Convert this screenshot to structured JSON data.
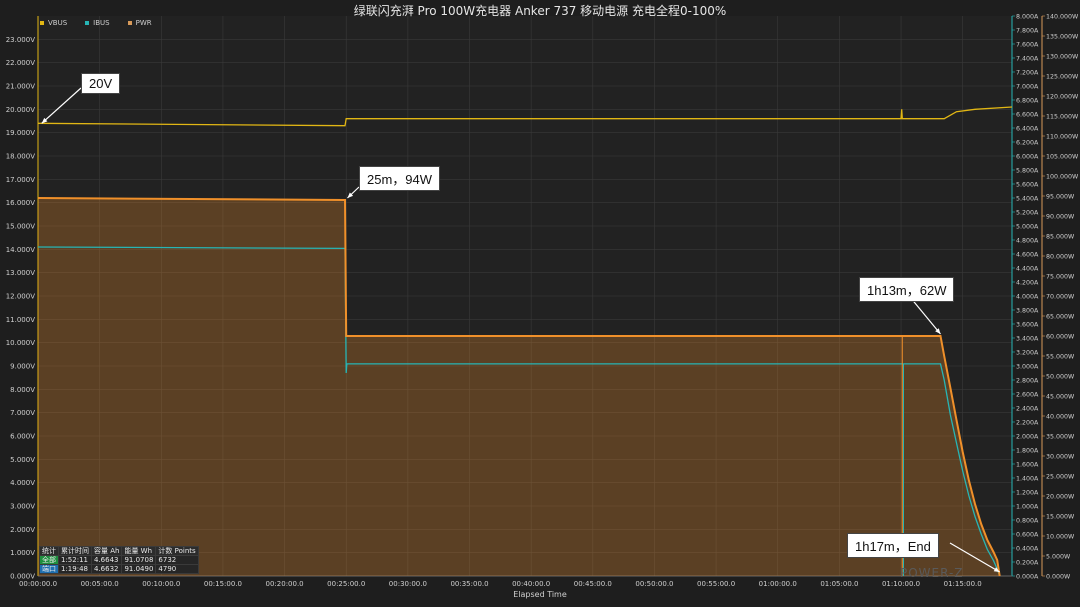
{
  "title": "绿联闪充湃 Pro 100W充电器 Anker 737 移动电源 充电全程0-100%",
  "legend": [
    {
      "name": "VBUS",
      "color": "#e2b714"
    },
    {
      "name": "IBUS",
      "color": "#27b5b5"
    },
    {
      "name": "PWR",
      "color": "#d89a5a"
    }
  ],
  "annotations": [
    {
      "id": "ann-20v",
      "text": "20V"
    },
    {
      "id": "ann-25m",
      "text": "25m，94W"
    },
    {
      "id": "ann-1h13m",
      "text": "1h13m，62W"
    },
    {
      "id": "ann-1h17m",
      "text": "1h17m，End"
    }
  ],
  "stats": {
    "headers": [
      "统计",
      "累计时间",
      "容量 Ah",
      "能量 Wh",
      "计数 Points"
    ],
    "rows": [
      [
        "全部",
        "1:52:11",
        "4.6643",
        "91.0708",
        "6732"
      ],
      [
        "端口",
        "1:19:48",
        "4.6632",
        "91.0490",
        "4790"
      ]
    ]
  },
  "watermark": "POWER-Z",
  "chart_data": {
    "type": "line",
    "xlabel": "Elapsed Time",
    "x_unit": "minutes",
    "xlim": [
      0,
      79
    ],
    "x_ticks": [
      "00:00:00.0",
      "00:05:00.0",
      "00:10:00.0",
      "00:15:00.0",
      "00:20:00.0",
      "00:25:00.0",
      "00:30:00.0",
      "00:35:00.0",
      "00:40:00.0",
      "00:45:00.0",
      "00:50:00.0",
      "00:55:00.0",
      "01:00:00.0",
      "01:05:00.0",
      "01:10:00.0",
      "01:15:00.0"
    ],
    "y_left": {
      "unit": "V",
      "ylim": [
        0,
        24
      ],
      "ticks": [
        "0.000V",
        "1.000V",
        "2.000V",
        "3.000V",
        "4.000V",
        "5.000V",
        "6.000V",
        "7.000V",
        "8.000V",
        "9.000V",
        "10.000V",
        "11.000V",
        "12.000V",
        "13.000V",
        "14.000V",
        "15.000V",
        "16.000V",
        "17.000V",
        "18.000V",
        "19.000V",
        "20.000V",
        "21.000V",
        "22.000V",
        "23.000V"
      ]
    },
    "y_right1": {
      "unit": "A",
      "ylim": [
        0,
        8.0
      ],
      "ticks": [
        "0.000A",
        "0.200A",
        "0.400A",
        "0.600A",
        "0.800A",
        "1.000A",
        "1.200A",
        "1.400A",
        "1.600A",
        "1.800A",
        "2.000A",
        "2.200A",
        "2.400A",
        "2.600A",
        "2.800A",
        "3.000A",
        "3.200A",
        "3.400A",
        "3.600A",
        "3.800A",
        "4.000A",
        "4.200A",
        "4.400A",
        "4.600A",
        "4.800A",
        "5.000A",
        "5.200A",
        "5.400A",
        "5.600A",
        "5.800A",
        "6.000A",
        "6.200A",
        "6.400A",
        "6.600A",
        "6.800A",
        "7.000A",
        "7.200A",
        "7.400A",
        "7.600A",
        "7.800A",
        "8.000A"
      ]
    },
    "y_right2": {
      "unit": "W",
      "ylim": [
        0,
        140
      ],
      "ticks": [
        "0.000W",
        "5.000W",
        "10.000W",
        "15.000W",
        "20.000W",
        "25.000W",
        "30.000W",
        "35.000W",
        "40.000W",
        "45.000W",
        "50.000W",
        "55.000W",
        "60.000W",
        "65.000W",
        "70.000W",
        "75.000W",
        "80.000W",
        "85.000W",
        "90.000W",
        "95.000W",
        "100.000W",
        "105.000W",
        "110.000W",
        "115.000W",
        "120.000W",
        "125.000W",
        "130.000W",
        "135.000W",
        "140.000W"
      ]
    },
    "grid": true,
    "legend_position": "top-left",
    "series": [
      {
        "name": "VBUS",
        "axis": "left",
        "color": "#e2b714",
        "points": [
          [
            0,
            19.4
          ],
          [
            24.9,
            19.3
          ],
          [
            25,
            19.6
          ],
          [
            70,
            19.6
          ],
          [
            70.05,
            20.0
          ],
          [
            70.1,
            19.6
          ],
          [
            73.5,
            19.6
          ],
          [
            74.5,
            19.9
          ],
          [
            76,
            20.0
          ],
          [
            79,
            20.1
          ]
        ]
      },
      {
        "name": "IBUS",
        "axis": "right1",
        "color": "#27b5b5",
        "points": [
          [
            0,
            4.7
          ],
          [
            24.9,
            4.68
          ],
          [
            25,
            2.9
          ],
          [
            25.05,
            3.03
          ],
          [
            73.2,
            3.03
          ],
          [
            73.5,
            2.8
          ],
          [
            74,
            2.3
          ],
          [
            74.5,
            1.9
          ],
          [
            75,
            1.5
          ],
          [
            75.5,
            1.15
          ],
          [
            76,
            0.85
          ],
          [
            76.5,
            0.6
          ],
          [
            77,
            0.38
          ],
          [
            77.5,
            0.22
          ],
          [
            77.8,
            0.1
          ],
          [
            78,
            0.0
          ]
        ]
      },
      {
        "name": "PWR",
        "axis": "right2",
        "color": "#f0902a",
        "points": [
          [
            0,
            94.5
          ],
          [
            24.9,
            94.0
          ],
          [
            25,
            60.0
          ],
          [
            73.2,
            60.0
          ],
          [
            73.5,
            55
          ],
          [
            74,
            47
          ],
          [
            74.5,
            39
          ],
          [
            75,
            31
          ],
          [
            75.5,
            24
          ],
          [
            76,
            18
          ],
          [
            76.5,
            13
          ],
          [
            77,
            9
          ],
          [
            77.5,
            6
          ],
          [
            77.8,
            4
          ],
          [
            78,
            0.0
          ]
        ]
      }
    ]
  }
}
